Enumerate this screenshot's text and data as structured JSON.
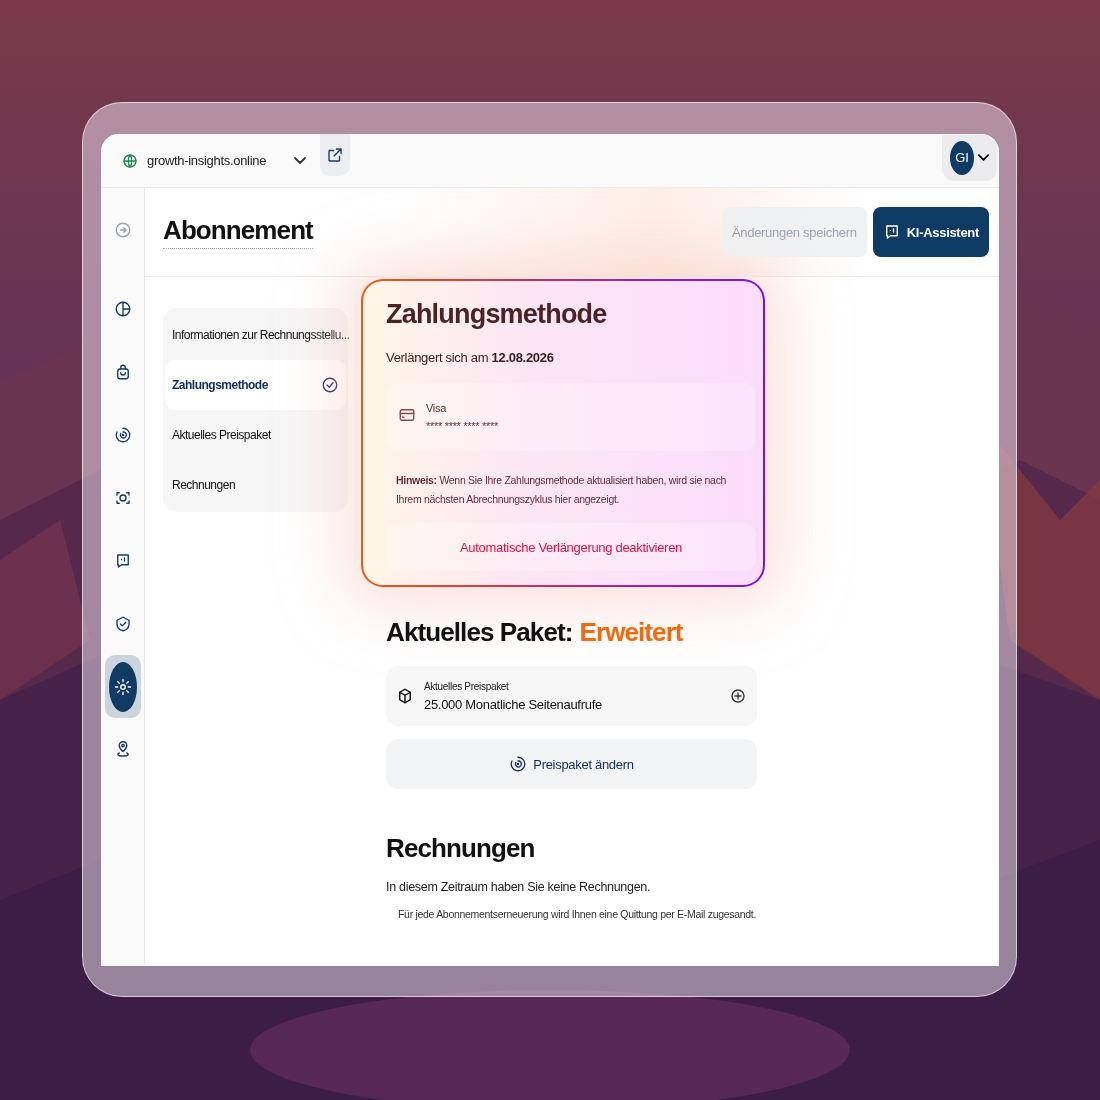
{
  "topbar": {
    "site": "growth-insights.online",
    "account_initials": "GI"
  },
  "sidebar": {
    "items": [
      {
        "kind": "pie",
        "selected": false
      },
      {
        "kind": "bag",
        "selected": false
      },
      {
        "kind": "spiral",
        "selected": false
      },
      {
        "kind": "scan",
        "selected": false
      },
      {
        "kind": "chat",
        "selected": false
      },
      {
        "kind": "shield",
        "selected": false
      },
      {
        "kind": "gear",
        "selected": true
      },
      {
        "kind": "pin",
        "selected": false
      }
    ]
  },
  "header": {
    "title": "Abonnement",
    "buttons": [
      {
        "label": "Änderungen speichern",
        "kind": "secondary",
        "disabled": true
      },
      {
        "label": "KI-Assistent",
        "kind": "primary",
        "disabled": false
      }
    ]
  },
  "section_nav": [
    {
      "label": "Informationen zur Rechnungsstellu...",
      "selected": false
    },
    {
      "label": "Zahlungsmethode",
      "selected": true
    },
    {
      "label": "Aktuelles Preispaket",
      "selected": false
    },
    {
      "label": "Rechnungen",
      "selected": false
    }
  ],
  "payment": {
    "title": "Zahlungsmethode",
    "renewal": "Verlängert sich am **12.08.2026**",
    "card_brand": "Visa",
    "card_number": "**** **** **** ****",
    "hint": "**Hinweis:** Wenn Sie Ihre Zahlungsmethode aktualisiert haben, wird sie nach Ihrem nächsten Abrechnungszyklus hier angezeigt.",
    "deactivate_button": "Automatische Verlängerung deaktivieren"
  },
  "package": {
    "heading": "Aktuelles Paket:",
    "plan": "Erweitert",
    "label": "Aktuelles Preispaket",
    "value": "25.000 Monatliche Seitenaufrufe",
    "change_button": "Preispaket ändern"
  },
  "invoices": {
    "title": "Rechnungen",
    "empty": "In diesem Zeitraum haben Sie keine Rechnungen.",
    "note": "Für jede Abonnementserneuerung wird Ihnen eine Quittung per E-Mail zugesandt."
  }
}
